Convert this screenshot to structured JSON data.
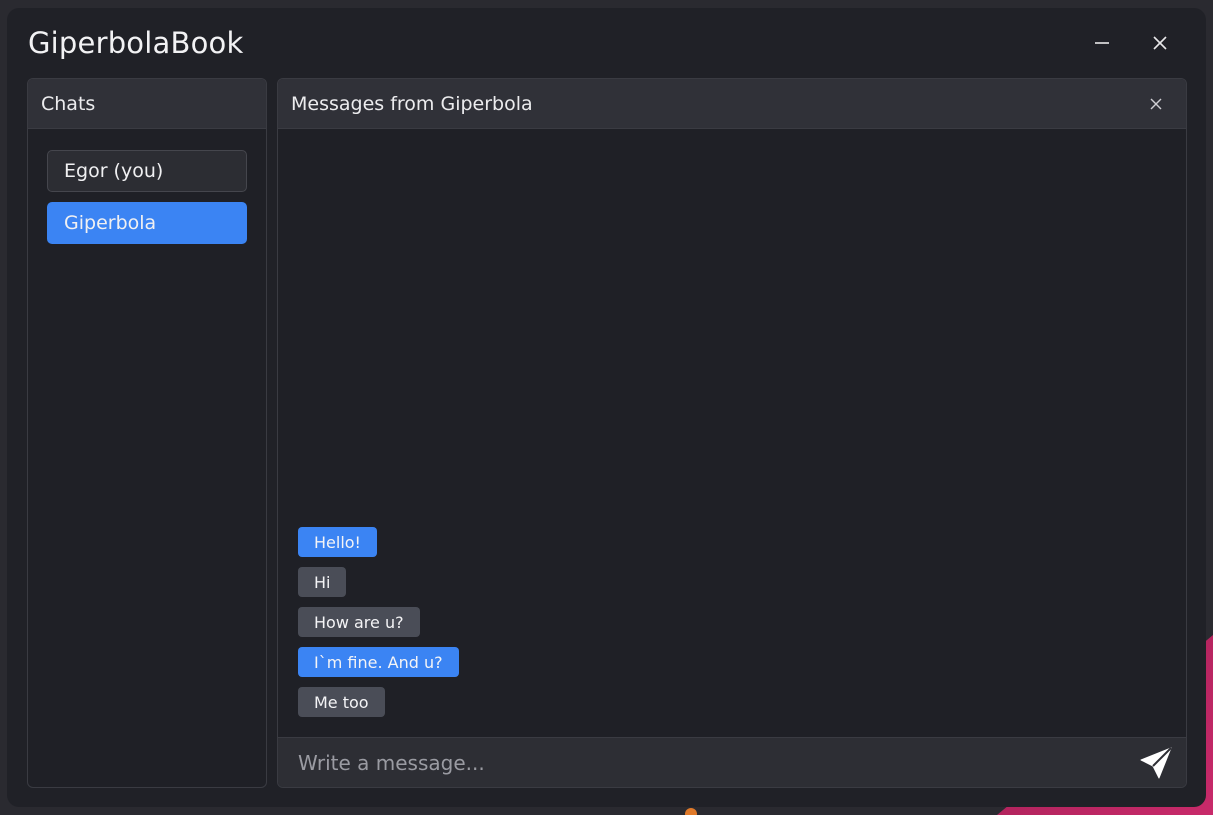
{
  "window": {
    "title": "GiperbolaBook",
    "minimize_icon": "minimize-icon",
    "close_icon": "close-icon"
  },
  "sidebar": {
    "header": "Chats",
    "items": [
      {
        "label": "Egor (you)",
        "active": false
      },
      {
        "label": "Giperbola",
        "active": true
      }
    ]
  },
  "conversation": {
    "header": "Messages from Giperbola",
    "close_icon": "close-icon",
    "messages": [
      {
        "text": "Hello!",
        "mine": true
      },
      {
        "text": "Hi",
        "mine": false
      },
      {
        "text": "How are u?",
        "mine": false
      },
      {
        "text": "I`m fine. And u?",
        "mine": true
      },
      {
        "text": "Me too",
        "mine": false
      }
    ],
    "composer": {
      "placeholder": "Write a message...",
      "value": "",
      "send_icon": "send-icon"
    }
  },
  "colors": {
    "accent": "#3b84f3",
    "bubble_other": "#4a4d57",
    "window_bg": "#202127"
  }
}
